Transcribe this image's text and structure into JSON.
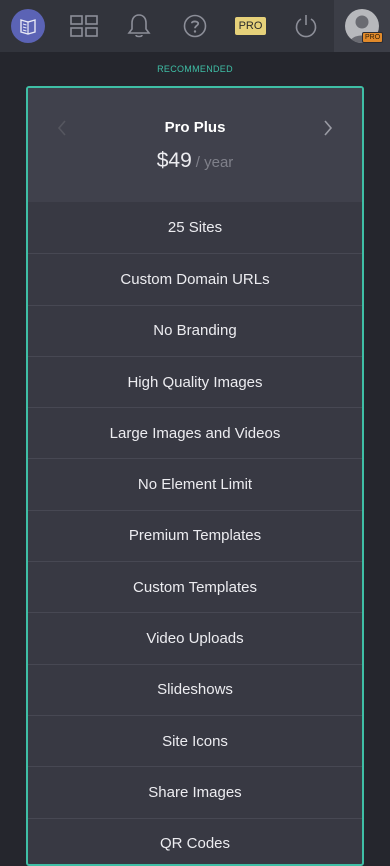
{
  "nav": {
    "pro_label": "PRO",
    "avatar_badge": "PRO"
  },
  "recommended_label": "RECOMMENDED",
  "plan": {
    "name": "Pro Plus",
    "price": "$49",
    "period": "/ year"
  },
  "features": [
    "25 Sites",
    "Custom Domain URLs",
    "No Branding",
    "High Quality Images",
    "Large Images and Videos",
    "No Element Limit",
    "Premium Templates",
    "Custom Templates",
    "Video Uploads",
    "Slideshows",
    "Site Icons",
    "Share Images",
    "QR Codes"
  ],
  "colors": {
    "accent": "#3fbfa6",
    "pro_badge": "#e6d17a",
    "logo": "#5b63b5"
  }
}
